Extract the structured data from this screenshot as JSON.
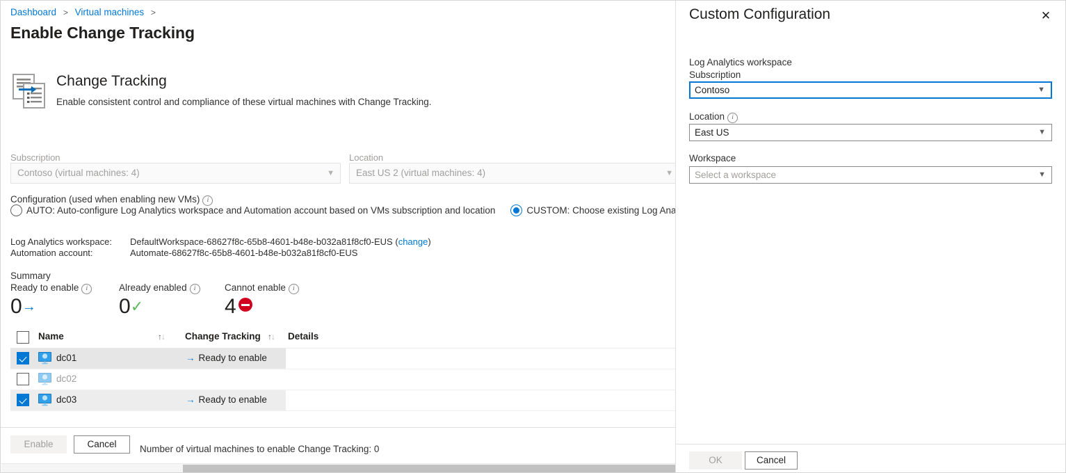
{
  "breadcrumb": {
    "items": [
      "Dashboard",
      "Virtual machines"
    ],
    "separator": ">"
  },
  "page_title": "Enable Change Tracking",
  "hero": {
    "icon": "change-tracking-icon",
    "title": "Change Tracking",
    "subtitle": "Enable consistent control and compliance of these virtual machines with Change Tracking."
  },
  "selectors": {
    "subscription_label": "Subscription",
    "subscription_value": "Contoso (virtual machines: 4)",
    "location_label": "Location",
    "location_value": "East US 2 (virtual machines: 4)"
  },
  "configuration": {
    "label": "Configuration (used when enabling new VMs)",
    "auto_label": "AUTO: Auto-configure Log Analytics workspace and Automation account based on VMs subscription and location",
    "custom_label": "CUSTOM: Choose existing Log Analytics workspa",
    "selected": "custom"
  },
  "workspace_info": {
    "law_key": "Log Analytics workspace:",
    "law_value": "DefaultWorkspace-68627f8c-65b8-4601-b48e-b032a81f8cf0-EUS",
    "law_change_link": "change",
    "aa_key": "Automation account:",
    "aa_value": "Automate-68627f8c-65b8-4601-b48e-b032a81f8cf0-EUS"
  },
  "summary": {
    "heading": "Summary",
    "items": [
      {
        "label": "Ready to enable",
        "value": "0",
        "glyph": "arrow-right-icon"
      },
      {
        "label": "Already enabled",
        "value": "0",
        "glyph": "check-icon"
      },
      {
        "label": "Cannot enable",
        "value": "4",
        "glyph": "blocked-icon"
      }
    ]
  },
  "table": {
    "columns": [
      "Name",
      "Change Tracking",
      "Details"
    ],
    "sort_glyph": "sort-ascending-descending-icon",
    "rows": [
      {
        "name": "dc01",
        "status": "Ready to enable",
        "details": "",
        "checked": true,
        "dim": false
      },
      {
        "name": "dc02",
        "status": "",
        "details": "",
        "checked": false,
        "dim": true
      },
      {
        "name": "dc03",
        "status": "Ready to enable",
        "details": "",
        "checked": true,
        "dim": false
      }
    ]
  },
  "footer": {
    "enable_label": "Enable",
    "cancel_label": "Cancel",
    "note": "Number of virtual machines to enable Change Tracking: 0"
  },
  "panel": {
    "title": "Custom Configuration",
    "close_glyph": "✕",
    "group_label": "Log Analytics workspace",
    "subscription_label": "Subscription",
    "subscription_value": "Contoso",
    "location_label": "Location",
    "location_value": "East US",
    "workspace_label": "Workspace",
    "workspace_placeholder": "Select a workspace",
    "ok_label": "OK",
    "cancel_label": "Cancel"
  },
  "colors": {
    "accent": "#0078d4",
    "danger": "#d1001f",
    "success": "#5cb85c",
    "text": "#201f1e",
    "muted": "#a19f9d"
  }
}
